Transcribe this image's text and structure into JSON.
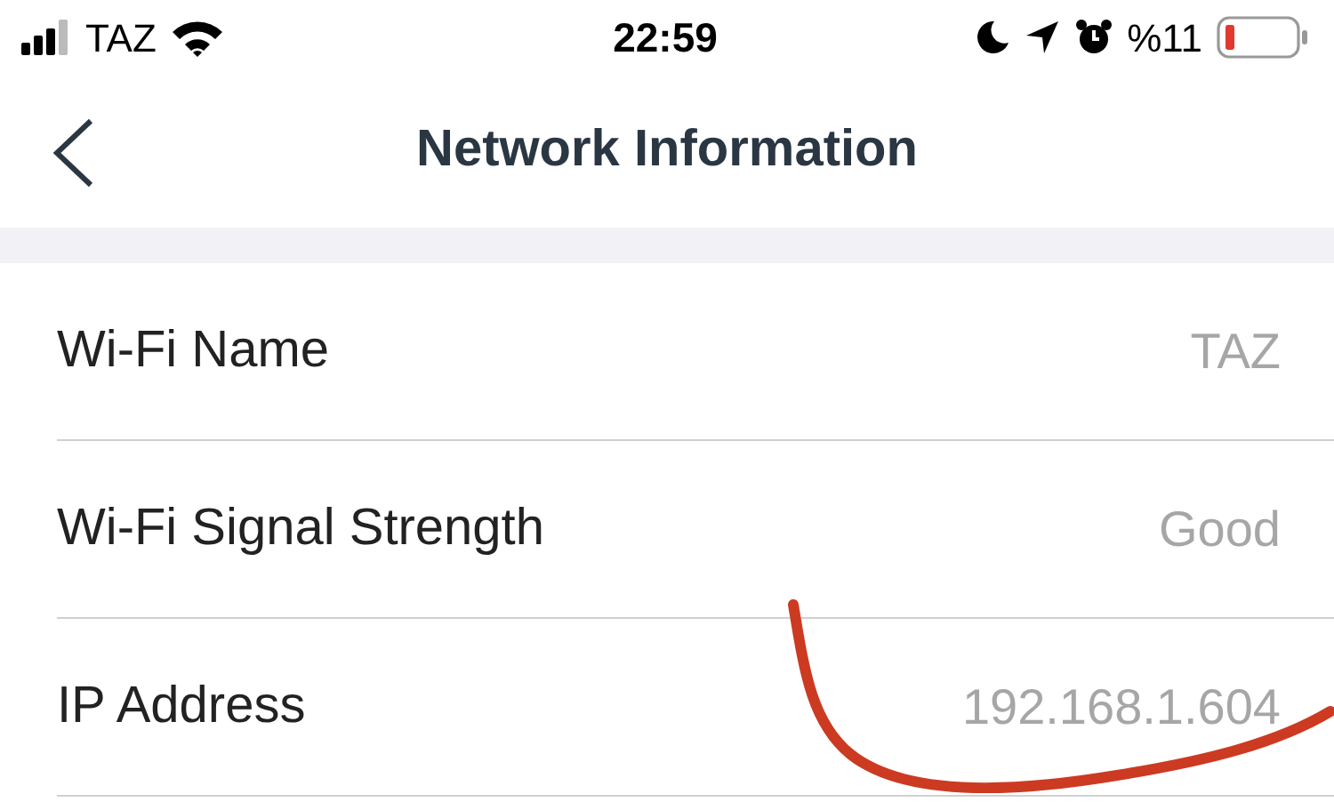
{
  "status_bar": {
    "carrier": "TAZ",
    "time": "22:59",
    "battery": "%11"
  },
  "nav": {
    "title": "Network Information"
  },
  "rows": [
    {
      "label": "Wi-Fi Name",
      "value": "TAZ"
    },
    {
      "label": "Wi-Fi Signal Strength",
      "value": "Good"
    },
    {
      "label": "IP Address",
      "value": "192.168.1.604"
    }
  ],
  "annotations": [
    {
      "kind": "stroke"
    }
  ]
}
